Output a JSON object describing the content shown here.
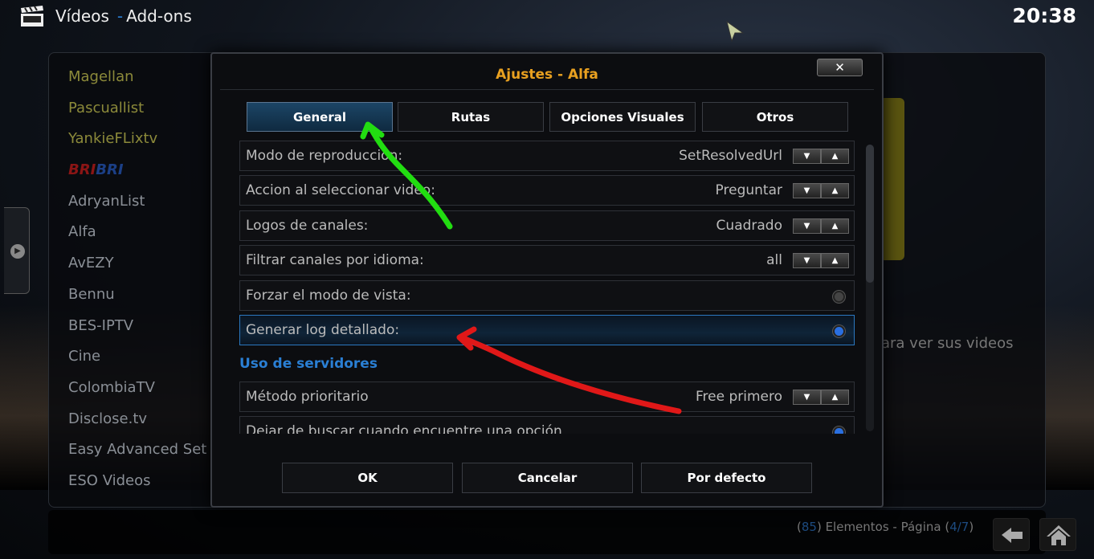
{
  "header": {
    "section": "Vídeos",
    "separator": "-",
    "subsection": "Add-ons",
    "clock": "20:38",
    "icon": "clapperboard-icon"
  },
  "addon_list": [
    "Magellan",
    "Pascuallist",
    "YankieFLixtv",
    "BRIBRI",
    "AdryanList",
    "Alfa",
    "AvEZY",
    "Bennu",
    "BES-IPTV",
    "Cine",
    "ColombiaTV",
    "Disclose.tv",
    "Easy Advanced Set",
    "ESO Videos"
  ],
  "bribri": {
    "part1": "BRI",
    "part2": "BRI"
  },
  "right_text": "ara ver sus videos",
  "footer": {
    "count": "85",
    "elements_label": ") Elementos - Página (",
    "page": "4/7",
    "open1": "(",
    "close1": ")",
    "back_icon": "back-arrow-icon",
    "home_icon": "home-icon"
  },
  "dialog": {
    "title": "Ajustes - Alfa",
    "close_label": "✕",
    "tabs": [
      {
        "label": "General",
        "active": true
      },
      {
        "label": "Rutas"
      },
      {
        "label": "Opciones Visuales"
      },
      {
        "label": "Otros"
      }
    ],
    "rows": [
      {
        "label": "Modo de reproducción:",
        "value": "SetResolvedUrl",
        "type": "spinner"
      },
      {
        "label": "Accion al seleccionar video:",
        "value": "Preguntar",
        "type": "spinner"
      },
      {
        "label": "Logos de canales:",
        "value": "Cuadrado",
        "type": "spinner"
      },
      {
        "label": "Filtrar canales por idioma:",
        "value": "all",
        "type": "spinner"
      },
      {
        "label": "Forzar el modo de vista:",
        "type": "radio",
        "checked": false
      },
      {
        "label": "Generar log detallado:",
        "type": "radio",
        "checked": true,
        "selected": true
      }
    ],
    "section": "Uso de servidores",
    "rows2": [
      {
        "label": "Método prioritario",
        "value": "Free primero",
        "type": "spinner"
      },
      {
        "label": "Dejar de buscar cuando encuentre una opción",
        "type": "radio",
        "checked": true
      }
    ],
    "buttons": {
      "ok": "OK",
      "cancel": "Cancelar",
      "default": "Por defecto"
    }
  },
  "colors": {
    "accent": "#2a7fd4",
    "title": "#e8a020",
    "annotation_green": "#22dd11",
    "annotation_red": "#e01818"
  }
}
